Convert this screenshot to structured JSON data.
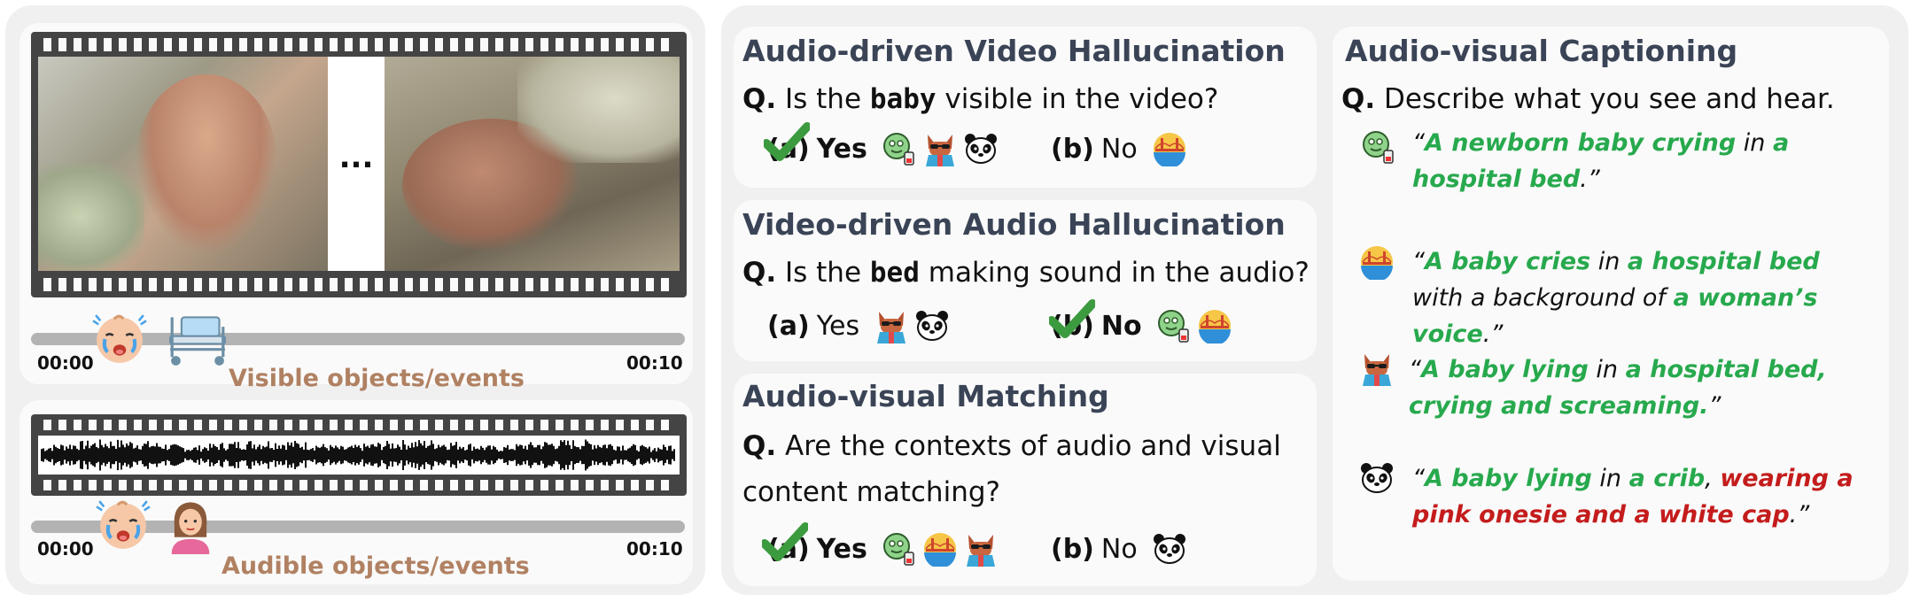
{
  "left": {
    "video_ellipsis": "...",
    "video_track": {
      "start": "00:00",
      "end": "00:10",
      "label": "Visible objects/events",
      "icons": [
        "crying-baby-icon",
        "hospital-bed-icon"
      ]
    },
    "audio_track": {
      "start": "00:00",
      "end": "00:10",
      "label": "Audible objects/events",
      "icons": [
        "crying-baby-icon",
        "woman-icon"
      ]
    }
  },
  "sections": [
    {
      "title": "Audio-driven Video Hallucination",
      "q_prefix": "Q.",
      "q_before": "Is the",
      "q_keyword": "baby",
      "q_after": "visible in the video?",
      "option_a": {
        "letter": "(a)",
        "text": "Yes",
        "correct": true,
        "models": [
          "alien-model-icon",
          "cat-model-icon",
          "panda-model-icon"
        ]
      },
      "option_b": {
        "letter": "(b)",
        "text": "No",
        "correct": false,
        "models": [
          "bridge-model-icon"
        ]
      }
    },
    {
      "title": "Video-driven Audio Hallucination",
      "q_prefix": "Q.",
      "q_before": "Is the",
      "q_keyword": "bed",
      "q_after": "making sound in the audio?",
      "option_a": {
        "letter": "(a)",
        "text": "Yes",
        "correct": false,
        "models": [
          "cat-model-icon",
          "panda-model-icon"
        ]
      },
      "option_b": {
        "letter": "(b)",
        "text": "No",
        "correct": true,
        "models": [
          "alien-model-icon",
          "bridge-model-icon"
        ]
      }
    },
    {
      "title": "Audio-visual Matching",
      "q_prefix": "Q.",
      "q_line1": "Are the contexts of audio and visual",
      "q_line2": "content matching?",
      "option_a": {
        "letter": "(a)",
        "text": "Yes",
        "correct": true,
        "models": [
          "alien-model-icon",
          "bridge-model-icon",
          "cat-model-icon"
        ]
      },
      "option_b": {
        "letter": "(b)",
        "text": "No",
        "correct": false,
        "models": [
          "panda-model-icon"
        ]
      }
    }
  ],
  "captioning": {
    "title": "Audio-visual Captioning",
    "q_prefix": "Q.",
    "question": "Describe what you see and hear.",
    "captions": [
      {
        "model": "alien-model-icon",
        "parts": [
          {
            "t": "“",
            "c": "n"
          },
          {
            "t": "A newborn baby crying",
            "c": "g"
          },
          {
            "t": " in ",
            "c": "n"
          },
          {
            "t": "a hospital bed",
            "c": "g"
          },
          {
            "t": ".”",
            "c": "n"
          }
        ]
      },
      {
        "model": "bridge-model-icon",
        "parts": [
          {
            "t": "“",
            "c": "n"
          },
          {
            "t": "A baby cries",
            "c": "g"
          },
          {
            "t": " in ",
            "c": "n"
          },
          {
            "t": "a hospital bed",
            "c": "g"
          },
          {
            "t": " with a background of ",
            "c": "n"
          },
          {
            "t": "a woman’s voice",
            "c": "g"
          },
          {
            "t": ".”",
            "c": "n"
          }
        ]
      },
      {
        "model": "cat-model-icon",
        "parts": [
          {
            "t": "“",
            "c": "n"
          },
          {
            "t": "A baby lying",
            "c": "g"
          },
          {
            "t": " in ",
            "c": "n"
          },
          {
            "t": "a hospital bed, crying and screaming.",
            "c": "g"
          },
          {
            "t": "”",
            "c": "n"
          }
        ]
      },
      {
        "model": "panda-model-icon",
        "parts": [
          {
            "t": "“",
            "c": "n"
          },
          {
            "t": "A baby lying",
            "c": "g"
          },
          {
            "t": " in ",
            "c": "n"
          },
          {
            "t": "a crib",
            "c": "g"
          },
          {
            "t": ", ",
            "c": "n"
          },
          {
            "t": "wearing a pink onesie and a white cap",
            "c": "r"
          },
          {
            "t": ".”",
            "c": "n"
          }
        ]
      }
    ]
  },
  "colors": {
    "correct": "#27a94d",
    "hallucinated": "#c41c1c",
    "event_label": "#b08162",
    "heading": "#3a4456"
  }
}
